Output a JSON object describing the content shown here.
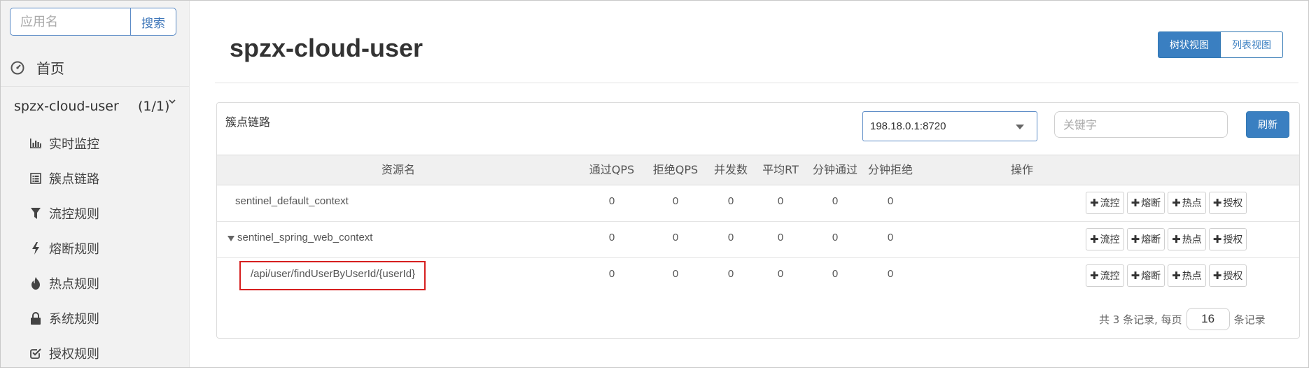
{
  "sidebar": {
    "search_placeholder": "应用名",
    "search_button": "搜索",
    "home_label": "首页",
    "app_name": "spzx-cloud-user",
    "app_count": "(1/1)",
    "menu": [
      {
        "label": "实时监控",
        "icon": "bar-chart-icon"
      },
      {
        "label": "簇点链路",
        "icon": "list-icon"
      },
      {
        "label": "流控规则",
        "icon": "filter-icon"
      },
      {
        "label": "熔断规则",
        "icon": "bolt-icon"
      },
      {
        "label": "热点规则",
        "icon": "fire-icon"
      },
      {
        "label": "系统规则",
        "icon": "lock-icon"
      },
      {
        "label": "授权规则",
        "icon": "check-square-icon"
      }
    ]
  },
  "main": {
    "page_title": "spzx-cloud-user",
    "view_tree": "树状视图",
    "view_list": "列表视图",
    "panel_title": "簇点链路",
    "machine_selected": "198.18.0.1:8720",
    "keyword_placeholder": "关键字",
    "refresh_button": "刷新",
    "table": {
      "headers": [
        "资源名",
        "通过QPS",
        "拒绝QPS",
        "并发数",
        "平均RT",
        "分钟通过",
        "分钟拒绝",
        "操作"
      ],
      "rows": [
        {
          "name": "sentinel_default_context",
          "pass_qps": "0",
          "block_qps": "0",
          "concurrency": "0",
          "avg_rt": "0",
          "minute_pass": "0",
          "minute_block": "0"
        },
        {
          "name": "sentinel_spring_web_context",
          "pass_qps": "0",
          "block_qps": "0",
          "concurrency": "0",
          "avg_rt": "0",
          "minute_pass": "0",
          "minute_block": "0"
        },
        {
          "name": "/api/user/findUserByUserId/{userId}",
          "pass_qps": "0",
          "block_qps": "0",
          "concurrency": "0",
          "avg_rt": "0",
          "minute_pass": "0",
          "minute_block": "0"
        }
      ],
      "op_buttons": [
        "流控",
        "熔断",
        "热点",
        "授权"
      ]
    },
    "pager": {
      "prefix": "共 3 条记录, 每页",
      "page_size": "16",
      "suffix": "条记录"
    }
  },
  "colors": {
    "accent": "#3a7fc1",
    "highlight": "#d61f1f",
    "sidebar_bg": "#f2f2f2"
  }
}
